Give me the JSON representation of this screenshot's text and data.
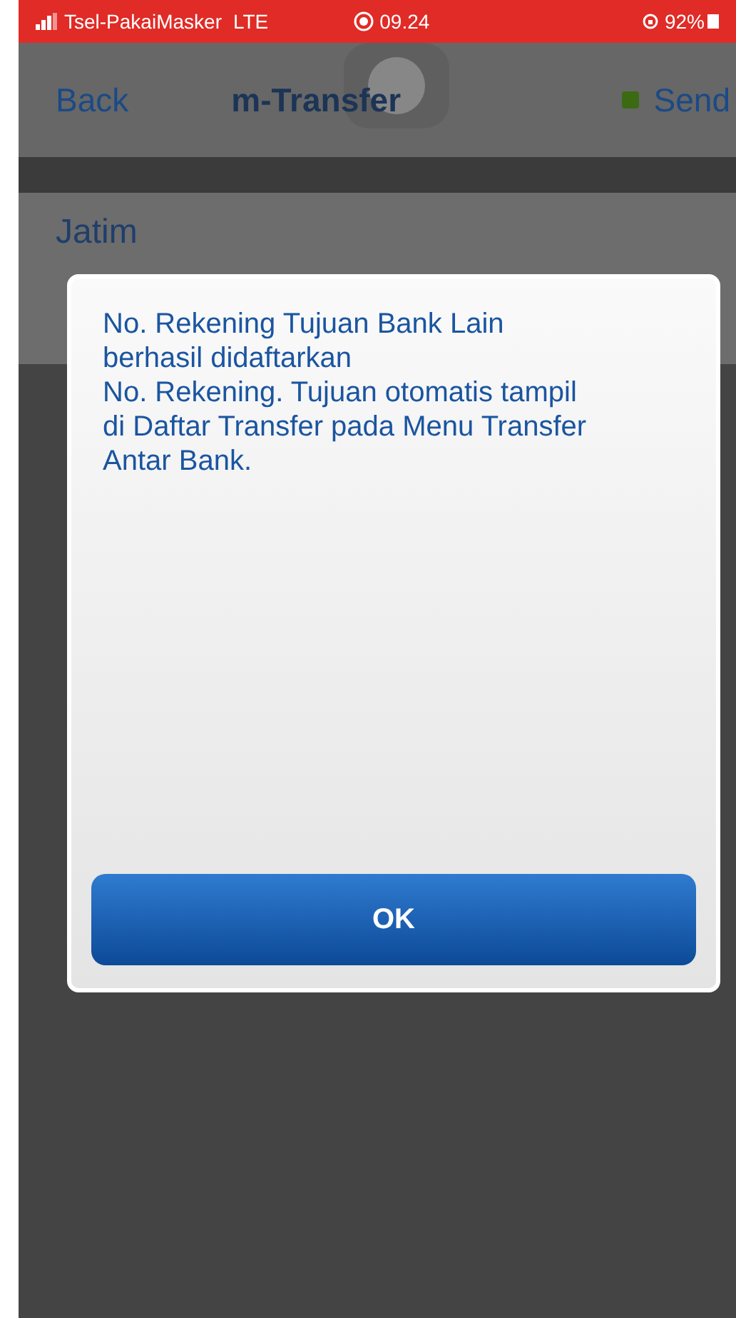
{
  "status_bar": {
    "carrier": "Tsel-PakaiMasker",
    "network": "LTE",
    "time": "09.24",
    "battery": "92%"
  },
  "nav": {
    "back": "Back",
    "title": "m-Transfer",
    "send": "Send"
  },
  "list": [
    {
      "bank": "Jatim"
    }
  ],
  "dialog": {
    "lines": [
      "No. Rekening Tujuan Bank Lain",
      "berhasil didaftarkan",
      "No. Rekening. Tujuan otomatis tampil",
      "di Daftar Transfer pada Menu Transfer",
      "Antar Bank."
    ],
    "button": "OK"
  }
}
